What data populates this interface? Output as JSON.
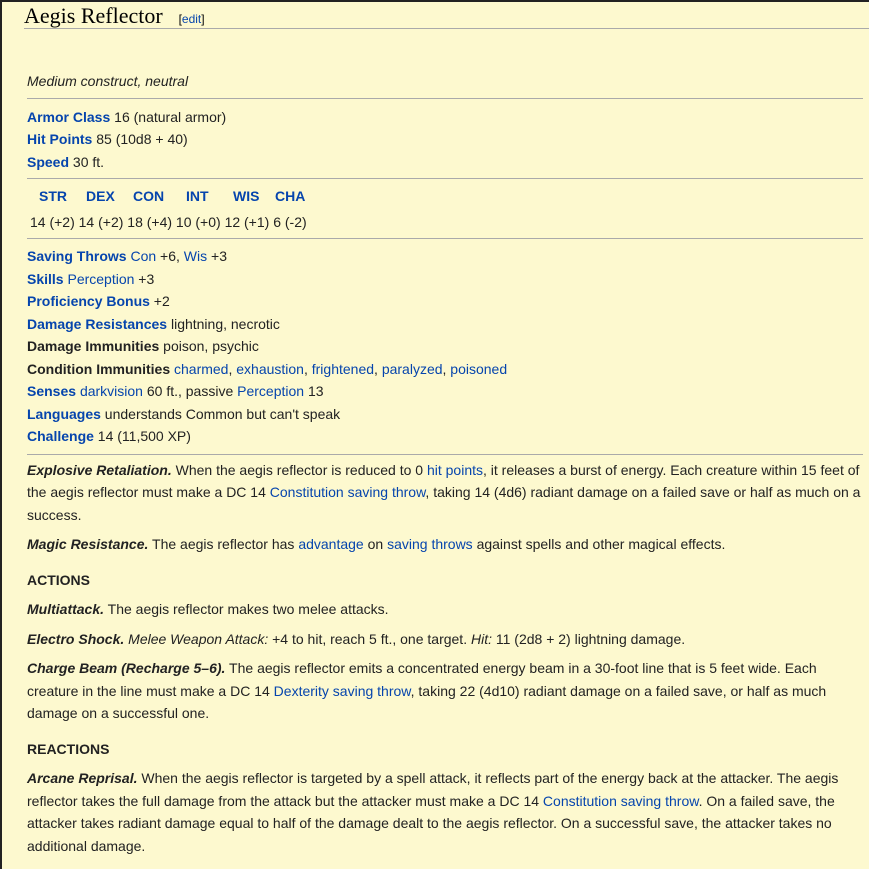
{
  "title": "Aegis Reflector",
  "edit": "edit",
  "subtitle": "Medium construct, neutral",
  "armor_class": {
    "label": "Armor Class",
    "value": "16 (natural armor)"
  },
  "hit_points": {
    "label": "Hit Points",
    "value": "85 (10d8 + 40)"
  },
  "speed": {
    "label": "Speed",
    "value": "30 ft."
  },
  "abilities": {
    "headers": [
      "STR",
      "DEX",
      "CON",
      "INT",
      "WIS",
      "CHA"
    ],
    "values": [
      "14 (+2)",
      "14 (+2)",
      "18 (+4)",
      "10 (+0)",
      "12 (+1)",
      "6 (-2)"
    ]
  },
  "saving_throws": {
    "label": "Saving Throws",
    "con": "Con",
    "con_val": " +6, ",
    "wis": "Wis",
    "wis_val": " +3"
  },
  "skills": {
    "label": "Skills",
    "perception": "Perception",
    "val": " +3"
  },
  "proficiency": {
    "label": "Proficiency Bonus",
    "value": " +2"
  },
  "damage_resistances": {
    "label": "Damage Resistances",
    "value": " lightning, necrotic"
  },
  "damage_immunities": {
    "label": "Damage Immunities",
    "value": " poison, psychic"
  },
  "condition_immunities": {
    "label": "Condition Immunities",
    "items": [
      "charmed",
      "exhaustion",
      "frightened",
      "paralyzed",
      "poisoned"
    ]
  },
  "senses": {
    "label": "Senses",
    "darkvision": "darkvision",
    "mid": " 60 ft., passive ",
    "perception": "Perception",
    "end": " 13"
  },
  "languages": {
    "label": "Languages",
    "value": " understands Common but can't speak"
  },
  "challenge": {
    "label": "Challenge",
    "value": " 14 (11,500 XP)"
  },
  "traits": {
    "explosive": {
      "name": "Explosive Retaliation.",
      "t1": " When the aegis reflector is reduced to 0 ",
      "l1": "hit points",
      "t2": ", it releases a burst of energy. Each creature within 15 feet of",
      "t3": "the aegis reflector must make a DC 14 ",
      "l2": "Constitution saving throw",
      "t4": ", taking 14 (4d6) radiant damage on a failed save or half as much on a",
      "t5": "success."
    },
    "magic": {
      "name": "Magic Resistance.",
      "t1": " The aegis reflector has ",
      "l1": "advantage",
      "t2": " on ",
      "l2": "saving throws",
      "t3": " against spells and other magical effects."
    }
  },
  "actions": {
    "heading": "ACTIONS",
    "multiattack": {
      "name": "Multiattack.",
      "text": " The aegis reflector makes two melee attacks."
    },
    "electro": {
      "name": "Electro Shock.",
      "type": " Melee Weapon Attack:",
      "t1": " +4 to hit, reach 5 ft., one target. ",
      "hit": "Hit:",
      "t2": " 11 (2d8 + 2) lightning damage."
    },
    "charge": {
      "name": "Charge Beam (Recharge 5–6).",
      "t1": " The aegis reflector emits a concentrated energy beam in a 30-foot line that is 5 feet wide. Each",
      "t2": "creature in the line must make a DC 14 ",
      "l1": "Dexterity saving throw",
      "t3": ", taking 22 (4d10) radiant damage on a failed save, or half as much",
      "t4": "damage on a successful one."
    }
  },
  "reactions": {
    "heading": "REACTIONS",
    "arcane": {
      "name": "Arcane Reprisal.",
      "t1": " When the aegis reflector is targeted by a spell attack, it reflects part of the energy back at the attacker. The aegis",
      "t2": "reflector takes the full damage from the attack but the attacker must make a DC 14 ",
      "l1": "Constitution saving throw",
      "t3": ". On a failed save, the",
      "t4": "attacker takes radiant damage equal to half of the damage dealt to the aegis reflector. On a successful save, the attacker takes no",
      "t5": "additional damage."
    }
  }
}
